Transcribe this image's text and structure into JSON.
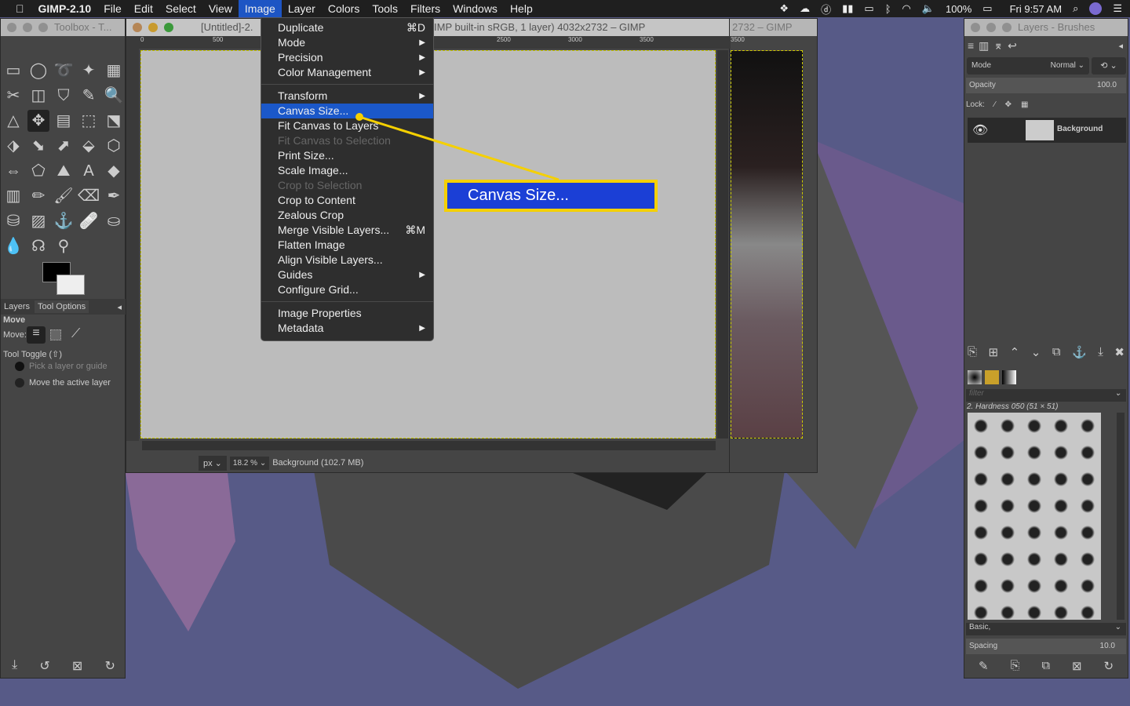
{
  "menubar": {
    "app": "GIMP-2.10",
    "items": [
      "File",
      "Edit",
      "Select",
      "View",
      "Image",
      "Layer",
      "Colors",
      "Tools",
      "Filters",
      "Windows",
      "Help"
    ],
    "active": "Image",
    "status": {
      "battery": "100%",
      "clock": "Fri 9:57 AM"
    }
  },
  "toolbox": {
    "title": "Toolbox - T...",
    "tabs": [
      "Layers",
      "Tool Options"
    ],
    "tool_name": "Move",
    "move_label": "Move:",
    "toggle_label": "Tool Toggle  (⇧)",
    "options": [
      "Pick a layer or guide",
      "Move the active layer"
    ]
  },
  "image_window": {
    "title_left": "[Untitled]-2.",
    "title_right": "IMP built-in sRGB, 1 layer) 4032x2732 – GIMP",
    "ruler": [
      "0",
      "500",
      "2500",
      "3000",
      "3500"
    ],
    "unit": "px",
    "zoom": "18.2 %",
    "status": "Background (102.7 MB)"
  },
  "back_window": {
    "title": "2732 – GIMP",
    "ruler": "3500"
  },
  "image_menu": {
    "items": [
      {
        "label": "Duplicate",
        "shortcut": "⌘D"
      },
      {
        "label": "Mode",
        "sub": true
      },
      {
        "label": "Precision",
        "sub": true
      },
      {
        "label": "Color Management",
        "sub": true
      },
      {
        "sep": true
      },
      {
        "label": "Transform",
        "sub": true
      },
      {
        "label": "Canvas Size...",
        "selected": true
      },
      {
        "label": "Fit Canvas to Layers"
      },
      {
        "label": "Fit Canvas to Selection",
        "disabled": true
      },
      {
        "label": "Print Size..."
      },
      {
        "label": "Scale Image..."
      },
      {
        "label": "Crop to Selection",
        "disabled": true
      },
      {
        "label": "Crop to Content"
      },
      {
        "label": "Zealous Crop"
      },
      {
        "label": "Merge Visible Layers...",
        "shortcut": "⌘M"
      },
      {
        "label": "Flatten Image"
      },
      {
        "label": "Align Visible Layers..."
      },
      {
        "label": "Guides",
        "sub": true
      },
      {
        "label": "Configure Grid..."
      },
      {
        "sep": true
      },
      {
        "label": "Image Properties"
      },
      {
        "label": "Metadata",
        "sub": true
      }
    ]
  },
  "callout": {
    "label": "Canvas Size...",
    "border": "#f5d000",
    "fill": "#1b3fd6"
  },
  "layers_panel": {
    "title": "Layers - Brushes",
    "mode_label": "Mode",
    "mode_value": "Normal",
    "opacity_label": "Opacity",
    "opacity_value": "100.0",
    "lock_label": "Lock:",
    "layer_name": "Background",
    "filter_placeholder": "filter",
    "brush_name": "2. Hardness 050 (51 × 51)",
    "preset": "Basic,",
    "spacing_label": "Spacing",
    "spacing_value": "10.0"
  }
}
